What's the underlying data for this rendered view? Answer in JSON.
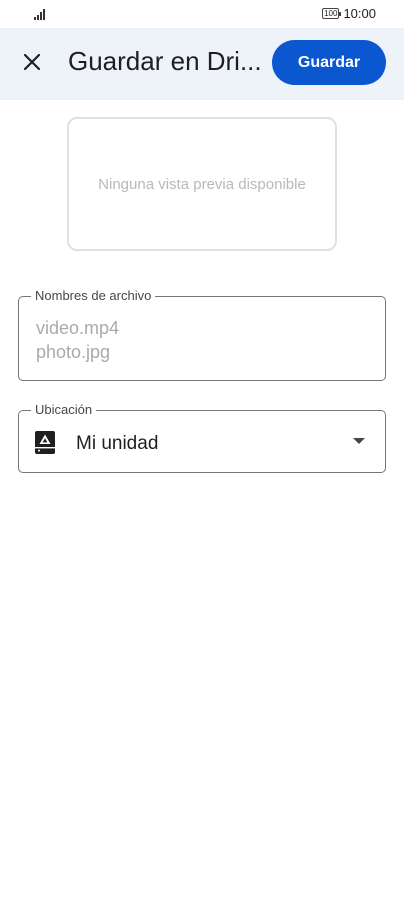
{
  "status_bar": {
    "battery": "100",
    "time": "10:00"
  },
  "header": {
    "title": "Guardar en Dri...",
    "save_label": "Guardar"
  },
  "preview": {
    "placeholder": "Ninguna vista previa disponible"
  },
  "file_names": {
    "label": "Nombres de archivo",
    "files": [
      "video.mp4",
      "photo.jpg"
    ]
  },
  "location": {
    "label": "Ubicación",
    "value": "Mi unidad"
  },
  "colors": {
    "accent": "#0b57d0",
    "appbar_background": "#eef2f9"
  },
  "icons": {
    "close": "close-icon",
    "drive": "drive-icon",
    "dropdown": "arrow-drop-down-icon",
    "signal": "signal-icon",
    "battery": "battery-icon"
  }
}
